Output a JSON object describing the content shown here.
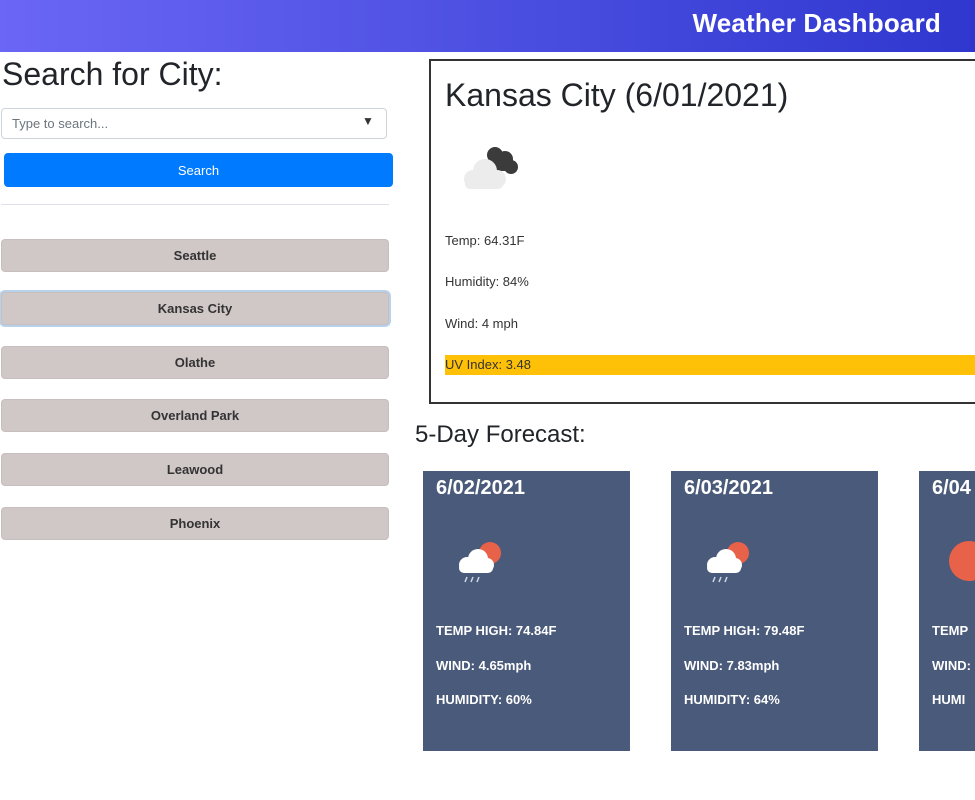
{
  "header": {
    "title": "Weather Dashboard"
  },
  "sidebar": {
    "heading": "Search for City:",
    "search_placeholder": "Type to search...",
    "search_button_label": "Search",
    "cities": [
      "Seattle",
      "Kansas City",
      "Olathe",
      "Overland Park",
      "Leawood",
      "Phoenix"
    ]
  },
  "current": {
    "title": "Kansas City (6/01/2021)",
    "icon": "broken-clouds-icon",
    "temp": "Temp: 64.31F",
    "humidity": "Humidity: 84%",
    "wind": "Wind: 4 mph",
    "uv": "UV Index: 3.48",
    "uv_color": "#ffc107"
  },
  "forecast": {
    "heading": "5-Day Forecast:",
    "card_color": "#4a5a7a",
    "days": [
      {
        "date": "6/02/2021",
        "icon": "rain-sun-icon",
        "temp": "TEMP HIGH: 74.84F",
        "wind": "WIND: 4.65mph",
        "humidity": "HUMIDITY: 60%"
      },
      {
        "date": "6/03/2021",
        "icon": "rain-sun-icon",
        "temp": "TEMP HIGH: 79.48F",
        "wind": "WIND: 7.83mph",
        "humidity": "HUMIDITY: 64%"
      },
      {
        "date": "6/04",
        "icon": "sun-icon",
        "temp": "TEMP",
        "wind": "WIND:",
        "humidity": "HUMI"
      }
    ]
  }
}
